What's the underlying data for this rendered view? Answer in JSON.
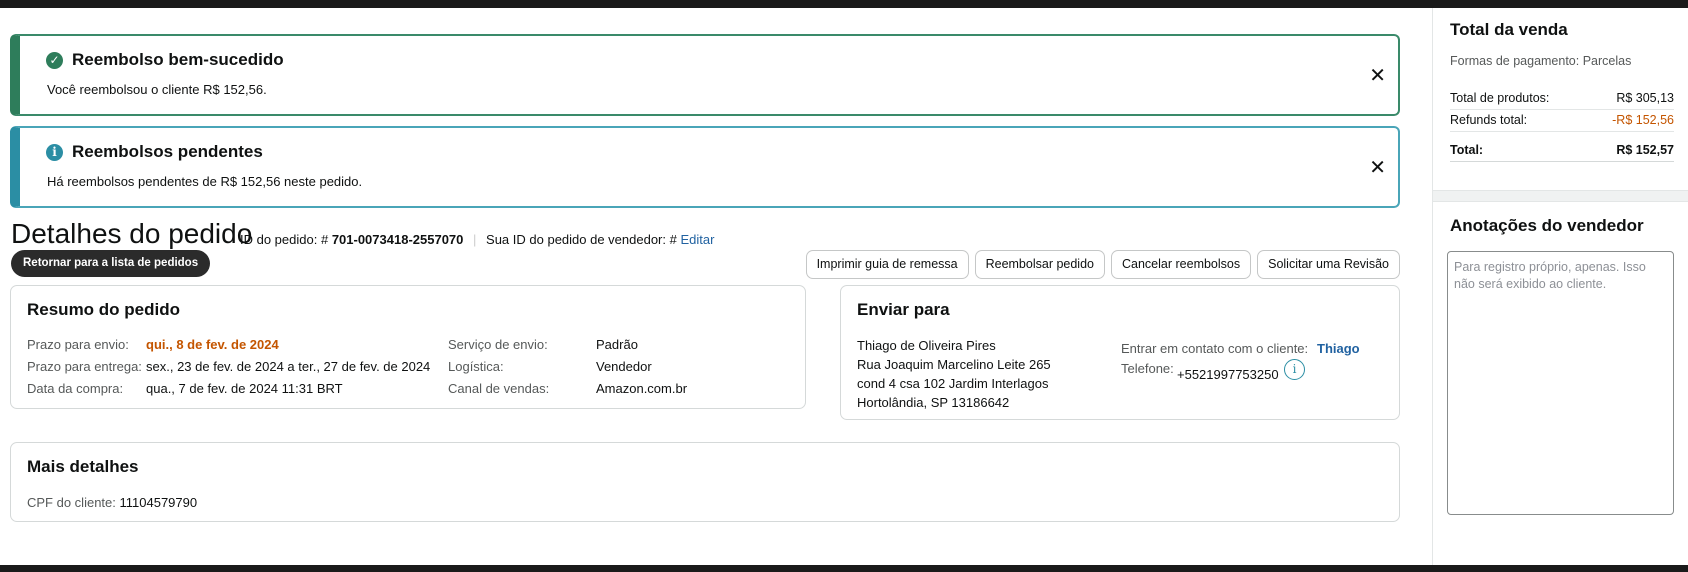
{
  "alerts": {
    "success": {
      "title": "Reembolso bem-sucedido",
      "body": "Você reembolsou o cliente R$ 152,56.",
      "close": "✕"
    },
    "pending": {
      "title": "Reembolsos pendentes",
      "body": "Há reembolsos pendentes de R$ 152,56 neste pedido.",
      "close": "✕"
    }
  },
  "header": {
    "title": "Detalhes do pedido",
    "order_id_label": "ID do pedido: #",
    "order_id": "701-0073418-2557070",
    "seller_id_label": "Sua ID do pedido de vendedor: #",
    "edit_link": "Editar",
    "back_button": "Retornar para a lista de pedidos"
  },
  "actions": [
    "Imprimir guia de remessa",
    "Reembolsar pedido",
    "Cancelar reembolsos",
    "Solicitar uma Revisão"
  ],
  "summary": {
    "title": "Resumo do pedido",
    "left": [
      {
        "label": "Prazo para envio:",
        "value": "qui., 8 de fev. de 2024"
      },
      {
        "label": "Prazo para entrega:",
        "value": "sex., 23 de fev. de 2024 a ter., 27 de fev. de 2024"
      },
      {
        "label": "Data da compra:",
        "value": "qua., 7 de fev. de 2024 11:31 BRT"
      }
    ],
    "right": [
      {
        "label": "Serviço de envio:",
        "value": "Padrão"
      },
      {
        "label": "Logística:",
        "value": "Vendedor"
      },
      {
        "label": "Canal de vendas:",
        "value": "Amazon.com.br"
      }
    ]
  },
  "ship_to": {
    "title": "Enviar para",
    "address": [
      "Thiago de Oliveira Pires",
      "Rua Joaquim Marcelino Leite 265",
      "cond 4 csa 102 Jardim Interlagos",
      "Hortolândia, SP 13186642"
    ],
    "contact_label": "Entrar em contato com o cliente:",
    "contact_name": "Thiago",
    "phone_label": "Telefone:",
    "phone": "+5521997753250",
    "info_icon": "i"
  },
  "more_details": {
    "title": "Mais detalhes",
    "cpf_label": "CPF do cliente:",
    "cpf": "11104579790"
  },
  "sidebar": {
    "total_title": "Total da venda",
    "payment": "Formas de pagamento: Parcelas",
    "rows": [
      {
        "label": "Total de produtos:",
        "value": "R$ 305,13"
      },
      {
        "label": "Refunds total:",
        "value": "-R$ 152,56"
      },
      {
        "label": "Total:",
        "value": "R$ 152,57"
      }
    ],
    "notes_title": "Anotações do vendedor",
    "notes_placeholder": "Para registro próprio, apenas. Isso não será exibido ao cliente."
  },
  "colors": {
    "success": "#2e7d5b",
    "info": "#2b8ea4",
    "link": "#2162a1",
    "warning": "#c45500"
  }
}
